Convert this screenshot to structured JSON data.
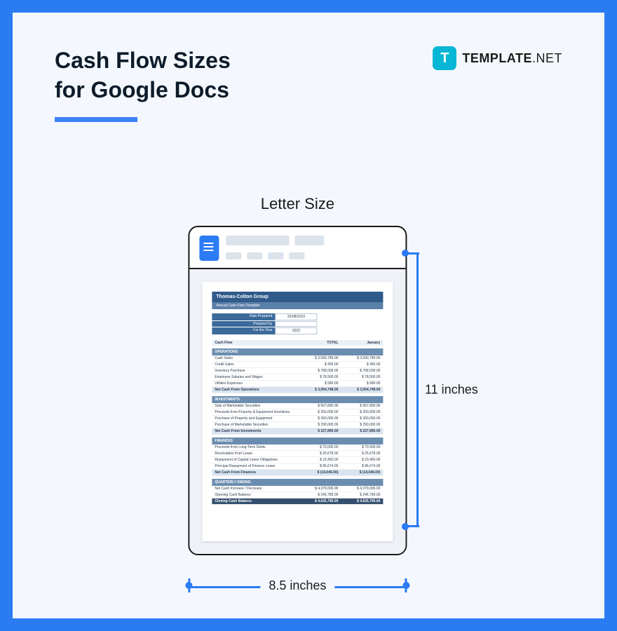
{
  "title_line1": "Cash Flow Sizes",
  "title_line2": "for Google Docs",
  "brand": {
    "icon_letter": "T",
    "name": "TEMPLATE",
    "suffix": ".NET"
  },
  "size_label": "Letter Size",
  "dimensions": {
    "width": "8.5 inches",
    "height": "11 inches"
  },
  "sheet": {
    "company": "Thomas-Colton Group",
    "subtitle": "Annual Cash Flow Template",
    "meta": [
      {
        "label": "Date Prepared",
        "value": "20/08/2023"
      },
      {
        "label": "Prepared by",
        "value": ""
      },
      {
        "label": "For the Year",
        "value": "2023"
      }
    ],
    "columns": [
      "Cash Flow",
      "TOTAL",
      "January"
    ],
    "sections": [
      {
        "name": "OPERATIONS",
        "rows": [
          {
            "label": "Cash Sales",
            "total": "3,590,789.00",
            "jan": "3,590,789.00"
          },
          {
            "label": "Credit Sales",
            "total": "455.00",
            "jan": "455.00"
          },
          {
            "label": "Inventory Purchase",
            "total": "768,009.00",
            "jan": "768,009.00"
          },
          {
            "label": "Employee Salaries and Wages",
            "total": "78,500.00",
            "jan": "78,500.00"
          },
          {
            "label": "Utilities Expenses",
            "total": "589.00",
            "jan": "589.00"
          }
        ],
        "summary": {
          "label": "Net Cash From Operations",
          "total": "3,054,748.00",
          "jan": "3,054,748.00"
        }
      },
      {
        "name": "INVESTMENTS",
        "rows": [
          {
            "label": "Sale of Marketable Securities",
            "total": "567,890.00",
            "jan": "567,890.00"
          },
          {
            "label": "Proceeds from Property & Equipment Incentives",
            "total": "250,000.00",
            "jan": "250,000.00"
          },
          {
            "label": "Purchase of Property and Equipment",
            "total": "300,000.00",
            "jan": "300,000.00"
          },
          {
            "label": "Purchase of Marketable Securities",
            "total": "290,000.00",
            "jan": "290,000.00"
          }
        ],
        "summary": {
          "label": "Net Cash From Investments",
          "total": "227,890.00",
          "jan": "227,890.00"
        }
      },
      {
        "name": "FINANCES",
        "rows": [
          {
            "label": "Proceeds from Long-Term Debts",
            "total": "70,000.00",
            "jan": "70,000.00"
          },
          {
            "label": "Receivables from Lease",
            "total": "25,678.00",
            "jan": "25,678.00"
          },
          {
            "label": "Repayment of Capital Lease Obligations",
            "total": "23,450.00",
            "jan": "23,450.00"
          },
          {
            "label": "Principal Repayment of Finance Lease",
            "total": "86,674.00",
            "jan": "86,674.00"
          }
        ],
        "summary": {
          "label": "Net Cash From Finances",
          "total": "(14,046.00)",
          "jan": "(14,046.00)"
        }
      },
      {
        "name": "QUARTERLY ENDING",
        "rows": [
          {
            "label": "Net Cash Increase / Decrease",
            "total": "4,379,006.00",
            "jan": "4,379,006.00"
          },
          {
            "label": "Opening Cash Balance",
            "total": "246,789.00",
            "jan": "246,789.00"
          }
        ],
        "final": {
          "label": "Closing Cash Balance",
          "total": "4,625,795.00",
          "jan": "4,625,795.00"
        }
      }
    ]
  }
}
